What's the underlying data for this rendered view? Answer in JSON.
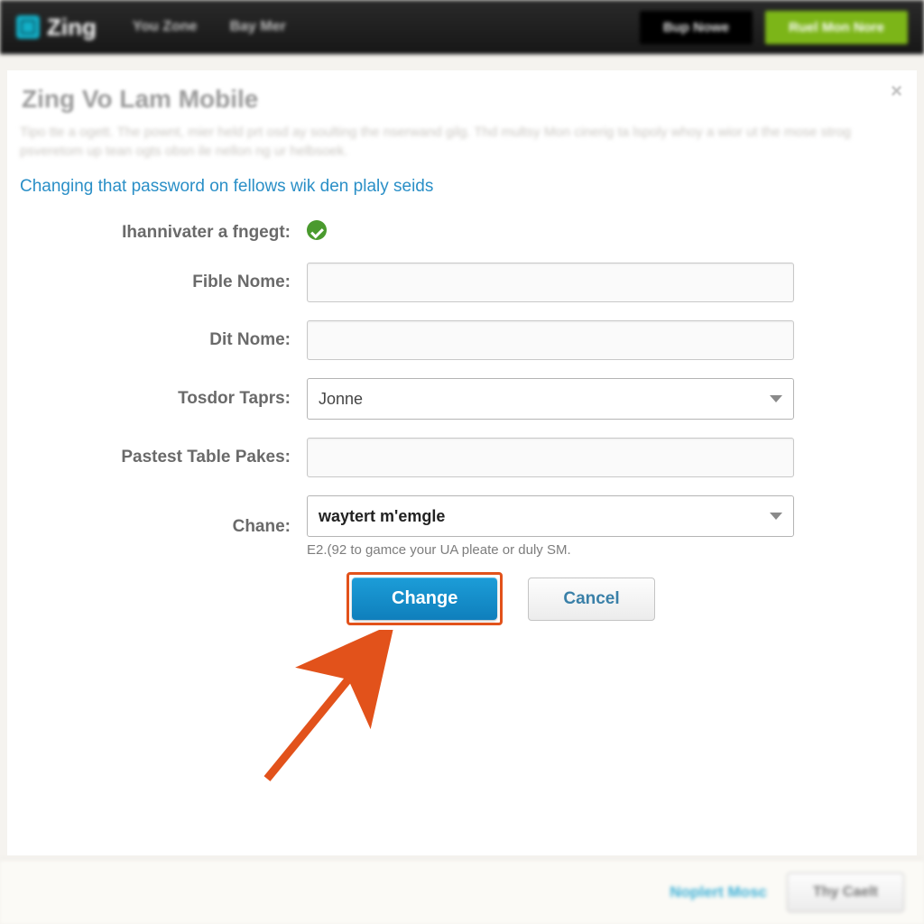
{
  "nav": {
    "brand": "Zing",
    "item1": "You Zone",
    "item2": "Bay Mer",
    "btn_dark": "Bup Nowe",
    "btn_green": "Ruel Mon Nore"
  },
  "modal": {
    "title": "Zing Vo Lam Mobile",
    "desc": "Tipo tte a ogett. The pownt, mier held prt osd ay soulting the nserwand gilg. Thd multsy Mon cinerig ta lspoly whoy a wior ut the mose strog psveretom up tean ogts obsn ile nellon ng ur helbsoek.",
    "link": "Changing that password on fellows wik den plaly seids",
    "close": "×"
  },
  "form": {
    "row1_label": "Ihannivater a fngegt:",
    "row2_label": "Fible Nome:",
    "row3_label": "Dit Nome:",
    "row4_label": "Tosdor Taprs:",
    "row4_value": "Jonne",
    "row5_label": "Pastest Table Pakes:",
    "row6_label": "Chane:",
    "row6_value": "waytert m'emgle",
    "row6_hint": "E2.(92 to gamce your UA pleate or duly SM."
  },
  "buttons": {
    "primary": "Change",
    "secondary": "Cancel"
  },
  "footer": {
    "link": "Noplert Mosc",
    "btn": "Thy Caelt"
  }
}
